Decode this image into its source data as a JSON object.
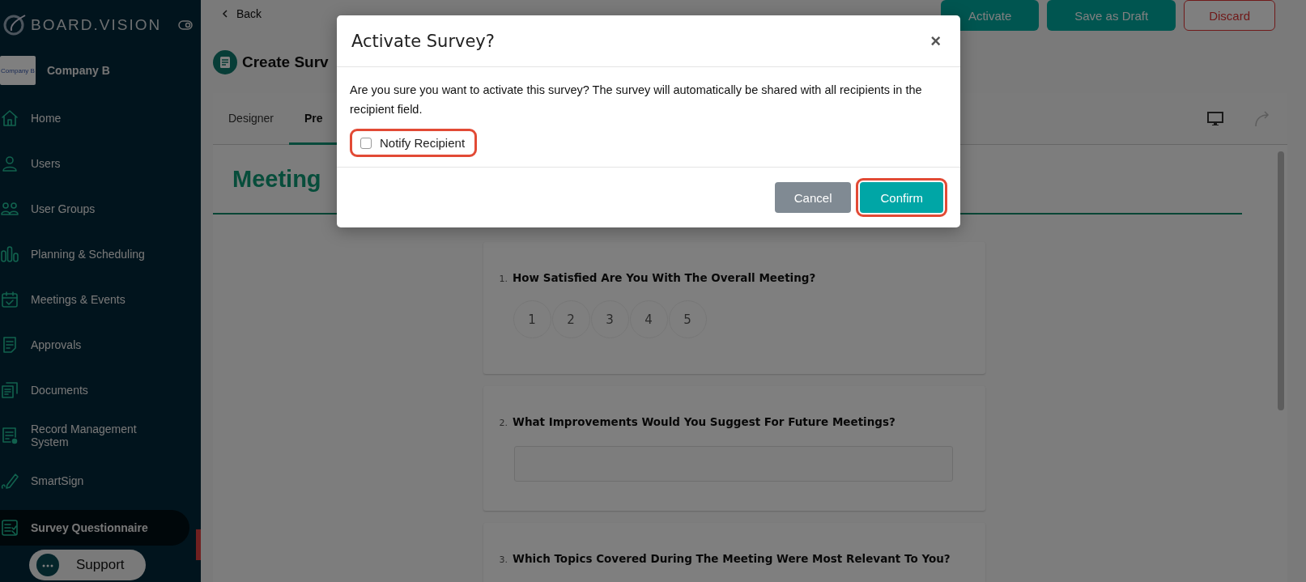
{
  "sidebar": {
    "brand": "BOARD.VISION",
    "company": {
      "name": "Company B",
      "logo_text": "Company B"
    },
    "items": [
      {
        "label": "Home",
        "selected": false
      },
      {
        "label": "Users",
        "selected": false
      },
      {
        "label": "User Groups",
        "selected": false
      },
      {
        "label": "Planning & Scheduling",
        "selected": false
      },
      {
        "label": "Meetings & Events",
        "selected": false
      },
      {
        "label": "Approvals",
        "selected": false
      },
      {
        "label": "Documents",
        "selected": false
      },
      {
        "label": "Record Management System",
        "selected": false
      },
      {
        "label": "SmartSign",
        "selected": false
      },
      {
        "label": "Survey Questionnaire",
        "selected": true
      }
    ],
    "support": "Support"
  },
  "topbar": {
    "back": "Back",
    "buttons": [
      {
        "label": "Activate",
        "kind": "primary"
      },
      {
        "label": "Save as Draft",
        "kind": "primary"
      },
      {
        "label": "Discard",
        "kind": "danger"
      }
    ]
  },
  "page_title": "Create Surv",
  "tabs": [
    {
      "label": "Designer",
      "selected": false
    },
    {
      "label": "Pre",
      "selected": true
    }
  ],
  "survey_title": "Meeting",
  "questions": [
    {
      "number": "1.",
      "text": "How Satisfied Are You With The Overall Meeting?",
      "kind": "rating",
      "options": [
        "1",
        "2",
        "3",
        "4",
        "5"
      ]
    },
    {
      "number": "2.",
      "text": "What Improvements Would You Suggest For Future Meetings?",
      "kind": "text"
    },
    {
      "number": "3.",
      "text": "Which Topics Covered During The Meeting Were Most Relevant To You?"
    }
  ],
  "modal": {
    "title": "Activate Survey?",
    "close": "×",
    "message": "Are you sure you want to activate this survey? The survey will automatically be shared with all recipients in the recipient field.",
    "notify": {
      "label": "Notify Recipient",
      "checked": false
    },
    "buttons": [
      {
        "label": "Cancel",
        "kind": "secondary"
      },
      {
        "label": "Confirm",
        "kind": "confirm"
      }
    ]
  }
}
